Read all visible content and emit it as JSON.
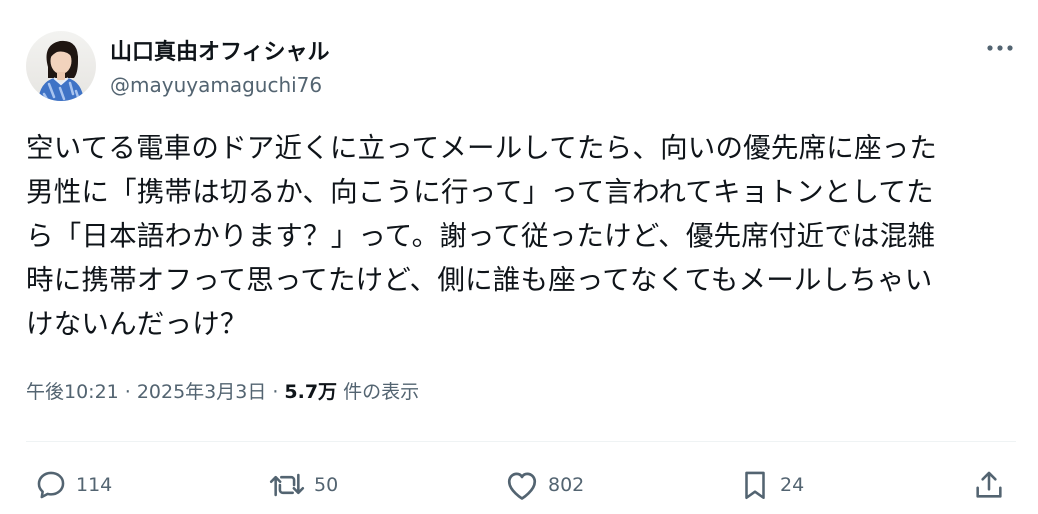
{
  "author": {
    "display_name": "山口真由オフィシャル",
    "handle": "@mayuyamaguchi76",
    "avatar_icon": "profile-photo"
  },
  "tweet": {
    "lines": [
      "空いてる電車のドア近くに立ってメールしてたら、向いの優先席に座った",
      "男性に「携帯は切るか、向こうに行って」って言われてキョトンとしてた",
      "ら「日本語わかります？」って。謝って従ったけど、優先席付近では混雑",
      "時に携帯オフって思ってたけど、側に誰も座ってなくてもメールしちゃい",
      "けないんだっけ？"
    ]
  },
  "meta": {
    "time": "午後10:21",
    "date": "2025年3月3日",
    "separator": "·",
    "views_count": "5.7万",
    "views_label": "件の表示"
  },
  "actions": {
    "reply_count": "114",
    "retweet_count": "50",
    "like_count": "802",
    "bookmark_count": "24"
  },
  "colors": {
    "text": "#0f1419",
    "secondary": "#536471",
    "divider": "#eff3f4"
  }
}
